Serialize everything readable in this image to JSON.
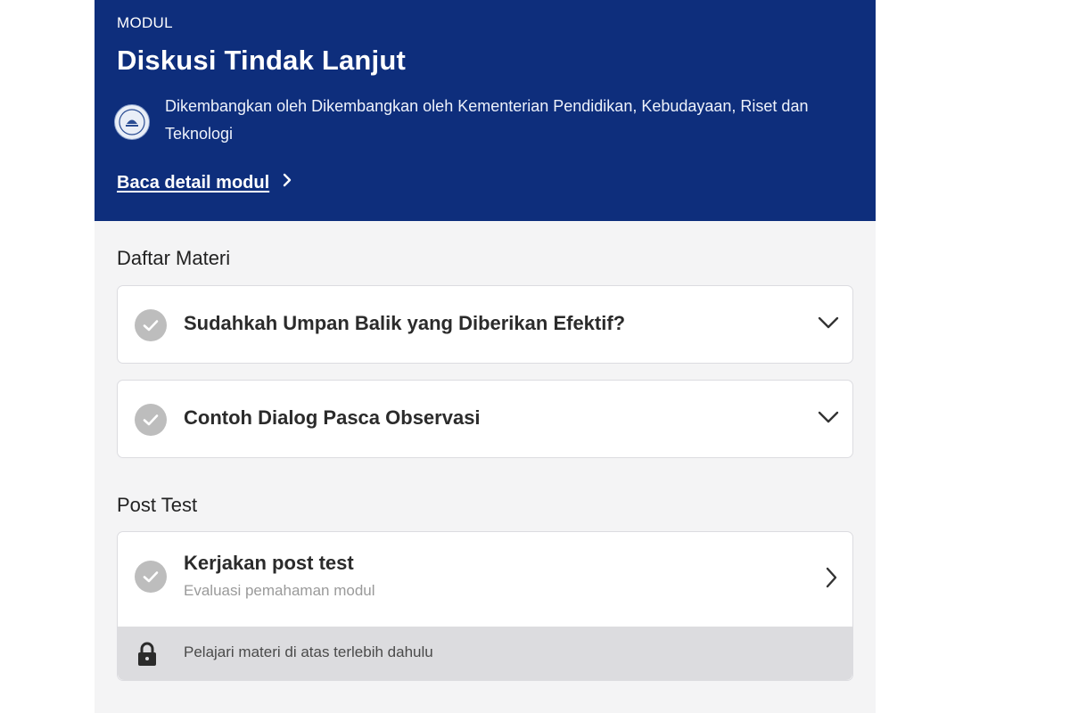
{
  "module": {
    "label": "MODUL",
    "title": "Diskusi Tindak Lanjut",
    "developer": "Dikembangkan oleh Dikembangkan oleh Kementerian Pendidikan, Kebudayaan, Riset dan Teknologi",
    "detail_link": "Baca detail modul"
  },
  "materials": {
    "heading": "Daftar Materi",
    "items": [
      {
        "title": "Sudahkah Umpan Balik yang Diberikan Efektif?"
      },
      {
        "title": "Contoh Dialog Pasca Observasi"
      }
    ]
  },
  "post_test": {
    "heading": "Post Test",
    "title": "Kerjakan post test",
    "subtitle": "Evaluasi pemahaman modul",
    "locked_note": "Pelajari materi di atas terlebih dahulu"
  },
  "colors": {
    "hero_bg": "#0e2e7c",
    "check_bg": "#bdbdbd",
    "lock_bar_bg": "#dcdcdf"
  },
  "icons": [
    "org-logo-icon",
    "chevron-right-icon",
    "check-circle-icon",
    "chevron-down-icon",
    "lock-icon"
  ]
}
